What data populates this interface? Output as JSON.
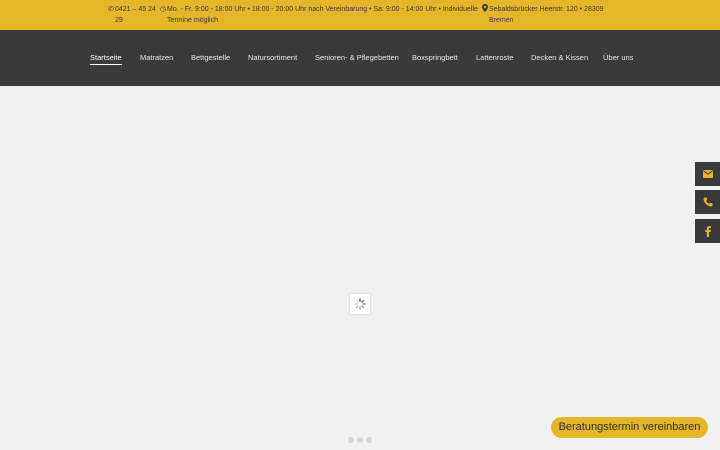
{
  "topbar": {
    "phone": "0421 – 45 24 29",
    "hours": "Mo. - Fr. 9:00 - 18:00 Uhr • 18:00 - 20:00 Uhr nach Vereinbarung • Sa: 9:00 - 14:00 Uhr • Individuelle Termine möglich",
    "address": "Sebaldsbrücker Heerstr. 120 • 28309 Bremen"
  },
  "nav": {
    "items": [
      {
        "label": "Startseite"
      },
      {
        "label": "Matratzen"
      },
      {
        "label": "Bettgestelle"
      },
      {
        "label": "Natursortiment"
      },
      {
        "label": "Senioren- & Pflegebetten"
      },
      {
        "label": "Boxspringbett"
      },
      {
        "label": "Lattenroste"
      },
      {
        "label": "Decken & Kissen"
      },
      {
        "label": "Über uns"
      }
    ],
    "active_index": 0
  },
  "slider": {
    "dot_count": 3
  },
  "side_tabs": [
    {
      "icon": "envelope-icon"
    },
    {
      "icon": "phone-icon"
    },
    {
      "icon": "facebook-icon"
    }
  ],
  "cta": {
    "label": "Beratungstermin vereinbaren"
  },
  "colors": {
    "accent": "#e6b62a",
    "dark": "#3a3a3a",
    "background": "#f1f1f1"
  }
}
